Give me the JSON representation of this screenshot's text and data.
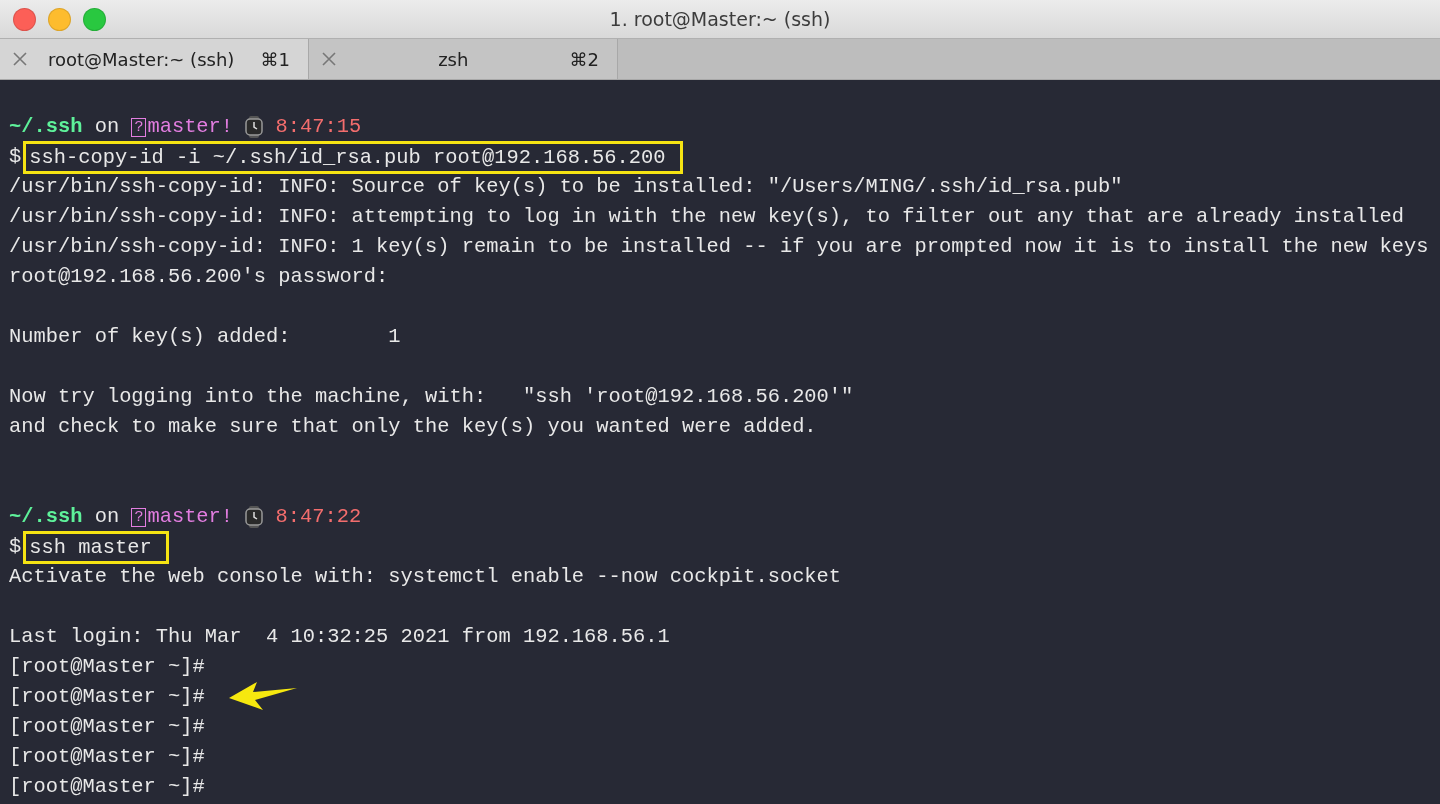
{
  "window": {
    "title": "1. root@Master:~ (ssh)"
  },
  "tabs": [
    {
      "label": "root@Master:~ (ssh)",
      "shortcut": "⌘1",
      "selected": true
    },
    {
      "label": "zsh",
      "shortcut": "⌘2",
      "selected": false
    }
  ],
  "terminal": {
    "lines": [
      {
        "kind": "blank"
      },
      {
        "kind": "prompt",
        "dir": "~/.ssh",
        "on": "on",
        "branch_glyph": "?",
        "branch": "master",
        "dirty": "!",
        "time": "8:47:15"
      },
      {
        "kind": "command",
        "symbol": "$",
        "text": "ssh-copy-id -i ~/.ssh/id_rsa.pub root@192.168.56.200",
        "highlighted": true
      },
      {
        "kind": "output",
        "text": "/usr/bin/ssh-copy-id: INFO: Source of key(s) to be installed: \"/Users/MING/.ssh/id_rsa.pub\""
      },
      {
        "kind": "output",
        "text": "/usr/bin/ssh-copy-id: INFO: attempting to log in with the new key(s), to filter out any that are already installed"
      },
      {
        "kind": "output",
        "text": "/usr/bin/ssh-copy-id: INFO: 1 key(s) remain to be installed -- if you are prompted now it is to install the new keys"
      },
      {
        "kind": "output",
        "text": "root@192.168.56.200's password:"
      },
      {
        "kind": "blank"
      },
      {
        "kind": "output",
        "text": "Number of key(s) added:        1"
      },
      {
        "kind": "blank"
      },
      {
        "kind": "output",
        "text": "Now try logging into the machine, with:   \"ssh 'root@192.168.56.200'\""
      },
      {
        "kind": "output",
        "text": "and check to make sure that only the key(s) you wanted were added."
      },
      {
        "kind": "blank"
      },
      {
        "kind": "blank"
      },
      {
        "kind": "prompt",
        "dir": "~/.ssh",
        "on": "on",
        "branch_glyph": "?",
        "branch": "master",
        "dirty": "!",
        "time": "8:47:22"
      },
      {
        "kind": "command",
        "symbol": "$",
        "text": "ssh master",
        "highlighted": true
      },
      {
        "kind": "output",
        "text": "Activate the web console with: systemctl enable --now cockpit.socket"
      },
      {
        "kind": "blank"
      },
      {
        "kind": "output",
        "text": "Last login: Thu Mar  4 10:32:25 2021 from 192.168.56.1"
      },
      {
        "kind": "output",
        "text": "[root@Master ~]#",
        "arrow": false
      },
      {
        "kind": "output",
        "text": "[root@Master ~]#",
        "arrow": true
      },
      {
        "kind": "output",
        "text": "[root@Master ~]#",
        "arrow": false
      },
      {
        "kind": "output",
        "text": "[root@Master ~]#",
        "arrow": false
      },
      {
        "kind": "output",
        "text": "[root@Master ~]#",
        "arrow": false
      }
    ]
  }
}
